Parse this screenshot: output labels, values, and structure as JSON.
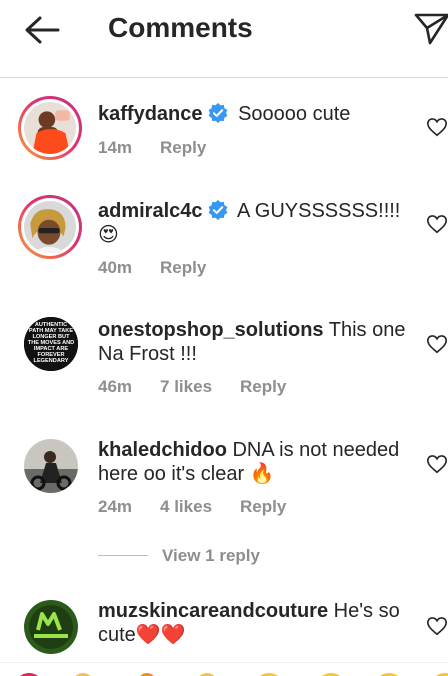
{
  "header": {
    "title": "Comments"
  },
  "comments": [
    {
      "username": "kaffydance",
      "verified": true,
      "text": "Sooooo cute",
      "time": "14m",
      "likes": "",
      "reply": "Reply"
    },
    {
      "username": "admiralc4c",
      "verified": true,
      "text": "A GUYSSSSSS!!!! 😍",
      "time": "40m",
      "likes": "",
      "reply": "Reply"
    },
    {
      "username": "onestopshop_solutions",
      "verified": false,
      "text": "This one Na Frost !!!",
      "time": "46m",
      "likes": "7 likes",
      "reply": "Reply"
    },
    {
      "username": "khaledchidoo",
      "verified": false,
      "text": "DNA is not needed here oo it's clear 🔥",
      "time": "24m",
      "likes": "4 likes",
      "reply": "Reply"
    },
    {
      "username": "muzskincareandcouture",
      "verified": false,
      "text": "He's so cute❤️❤️",
      "time": "",
      "likes": "",
      "reply": ""
    }
  ],
  "view_replies": "View 1 reply",
  "avatar_texts": {
    "onestopshop": "AUTHENTIC PATH MAY TAKE LONGER BUT THE MOVES AND IMPACT ARE FOREVER LEGENDARY"
  },
  "icons": {
    "back": "arrow-left-icon",
    "send": "paper-plane-icon",
    "verified": "verified-badge-icon",
    "like": "heart-outline-icon"
  },
  "colors": {
    "verified": "#3897f0",
    "meta": "#8e8e8e",
    "ring_start": "#f9a13a",
    "ring_end": "#c13584"
  }
}
